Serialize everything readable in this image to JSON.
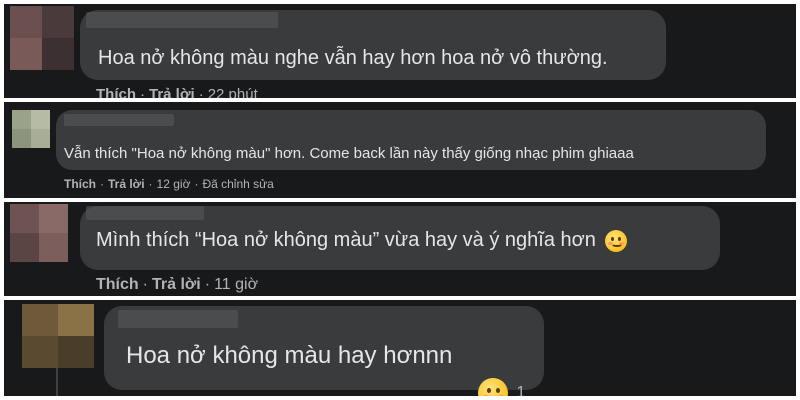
{
  "comments": [
    {
      "text": "Hoa nở không màu nghe vẫn hay hơn hoa nở vô thường.",
      "like": "Thích",
      "reply": "Trả lời",
      "time": "22 phút"
    },
    {
      "text": "Vẫn thích \"Hoa nở không màu\" hơn. Come back lần này thấy giống nhạc phim ghiaaa",
      "like": "Thích",
      "reply": "Trả lời",
      "time": "12 giờ",
      "edited": "Đã chỉnh sửa"
    },
    {
      "text": "Mình thích “Hoa nở không màu” vừa hay và ý nghĩa hơn",
      "like": "Thích",
      "reply": "Trả lời",
      "time": "11 giờ",
      "emoji": "smiling-face-emoji"
    },
    {
      "text": "Hoa nở không màu hay hơnnn",
      "reaction_count": "1",
      "reaction_icon": "care-reaction-icon"
    }
  ],
  "colors": {
    "panel_bg": "#18191a",
    "bubble_bg": "#3a3b3c",
    "text": "#e4e6eb",
    "meta": "#b0b3b8"
  }
}
